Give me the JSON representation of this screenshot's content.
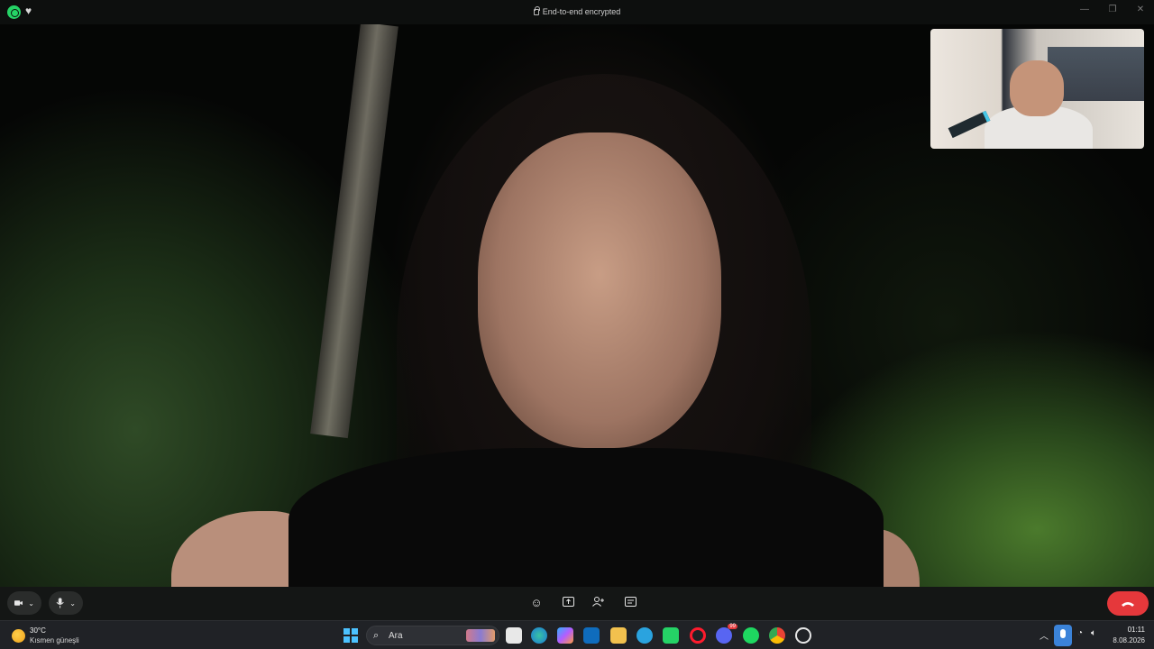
{
  "window": {
    "encryption_status": "End-to-end encrypted",
    "controls": {
      "minimize": "—",
      "maximize": "❐",
      "close": "✕"
    }
  },
  "call": {
    "remote_video": "video-feed",
    "self_view": "self-view-feed",
    "controls": {
      "camera_icon": "camera-icon",
      "mic_icon": "microphone-icon",
      "emoji_icon": "emoji-icon",
      "share_screen_icon": "share-screen-icon",
      "add_participant_icon": "add-person-icon",
      "captions_icon": "captions-icon",
      "end_call_icon": "phone-hangup-icon"
    },
    "colors": {
      "end_call": "#e5383b"
    }
  },
  "taskbar": {
    "weather": {
      "temperature": "30°C",
      "condition": "Kısmen güneşli"
    },
    "search_placeholder": "Ara",
    "apps": [
      "file-explorer",
      "edge",
      "copilot",
      "outlook",
      "files",
      "telegram",
      "whatsapp",
      "opera",
      "discord",
      "spotify",
      "chrome",
      "snipping-tool"
    ],
    "discord_badge": "99",
    "clock": {
      "time": "01:11",
      "date": "8.08.2026"
    }
  }
}
